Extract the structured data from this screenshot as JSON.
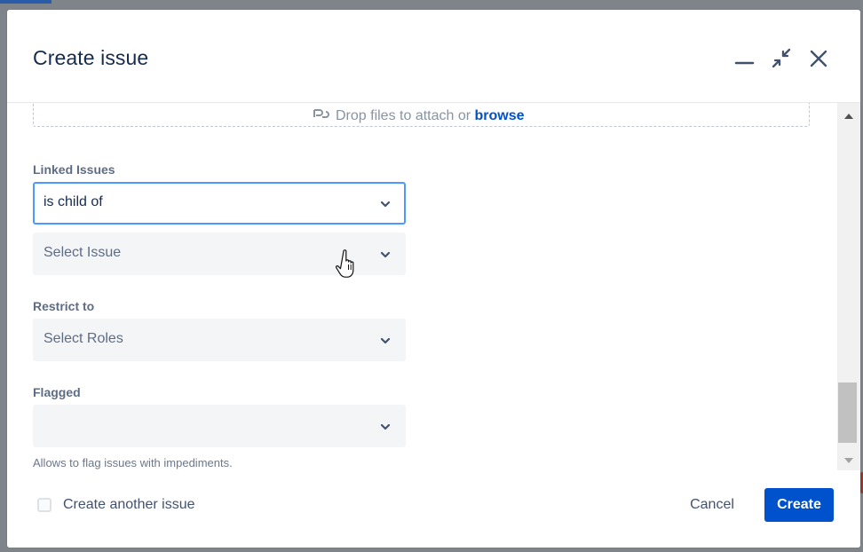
{
  "dialog": {
    "title": "Create issue",
    "minimize_icon": "minimize-icon",
    "collapse_icon": "collapse-arrows-icon",
    "close_icon": "close-icon"
  },
  "attachment": {
    "text": "Drop files to attach or",
    "link": "browse",
    "icon": "paperclip-icon"
  },
  "fields": {
    "linked_issues": {
      "label": "Linked Issues",
      "relation_value": "is child of",
      "issue_placeholder": "Select Issue"
    },
    "restrict_to": {
      "label": "Restrict to",
      "placeholder": "Select Roles"
    },
    "flagged": {
      "label": "Flagged",
      "value": "",
      "helper": "Allows to flag issues with impediments."
    }
  },
  "footer": {
    "create_another_label": "Create another issue",
    "create_another_checked": false,
    "cancel_label": "Cancel",
    "create_label": "Create"
  },
  "colors": {
    "primary": "#0052cc",
    "focus_border": "#4c9aff",
    "title": "#172b4d"
  }
}
